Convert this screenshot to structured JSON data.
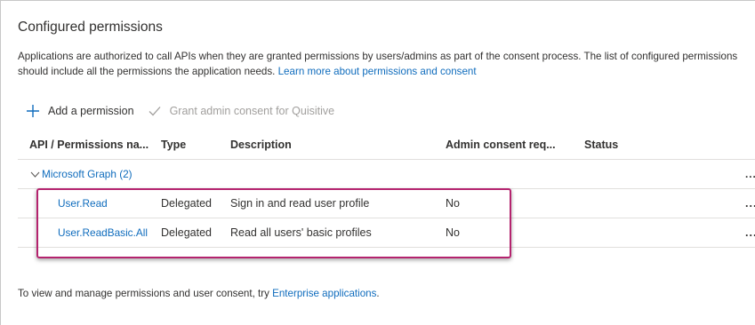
{
  "section": {
    "title": "Configured permissions",
    "description": "Applications are authorized to call APIs when they are granted permissions by users/admins as part of the consent process. The list of configured permissions should include all the permissions the application needs.",
    "learn_more_link": "Learn more about permissions and consent"
  },
  "toolbar": {
    "add_permission_label": "Add a permission",
    "add_icon": "plus-icon",
    "grant_consent_label": "Grant admin consent for Quisitive",
    "grant_icon": "checkmark-icon"
  },
  "table": {
    "headers": {
      "api": "API / Permissions na...",
      "type": "Type",
      "description": "Description",
      "admin_consent": "Admin consent req...",
      "status": "Status"
    },
    "group": {
      "label": "Microsoft Graph (2)",
      "more": "..."
    },
    "rows": [
      {
        "name": "User.Read",
        "type": "Delegated",
        "description": "Sign in and read user profile",
        "admin_consent": "No",
        "status": "",
        "more": "..."
      },
      {
        "name": "User.ReadBasic.All",
        "type": "Delegated",
        "description": "Read all users' basic profiles",
        "admin_consent": "No",
        "status": "",
        "more": "..."
      }
    ]
  },
  "footer": {
    "text": "To view and manage permissions and user consent, try",
    "link": "Enterprise applications",
    "suffix": "."
  },
  "colors": {
    "link": "#0f6cbd",
    "highlight_border": "#b4236e",
    "disabled": "#a19f9d"
  }
}
